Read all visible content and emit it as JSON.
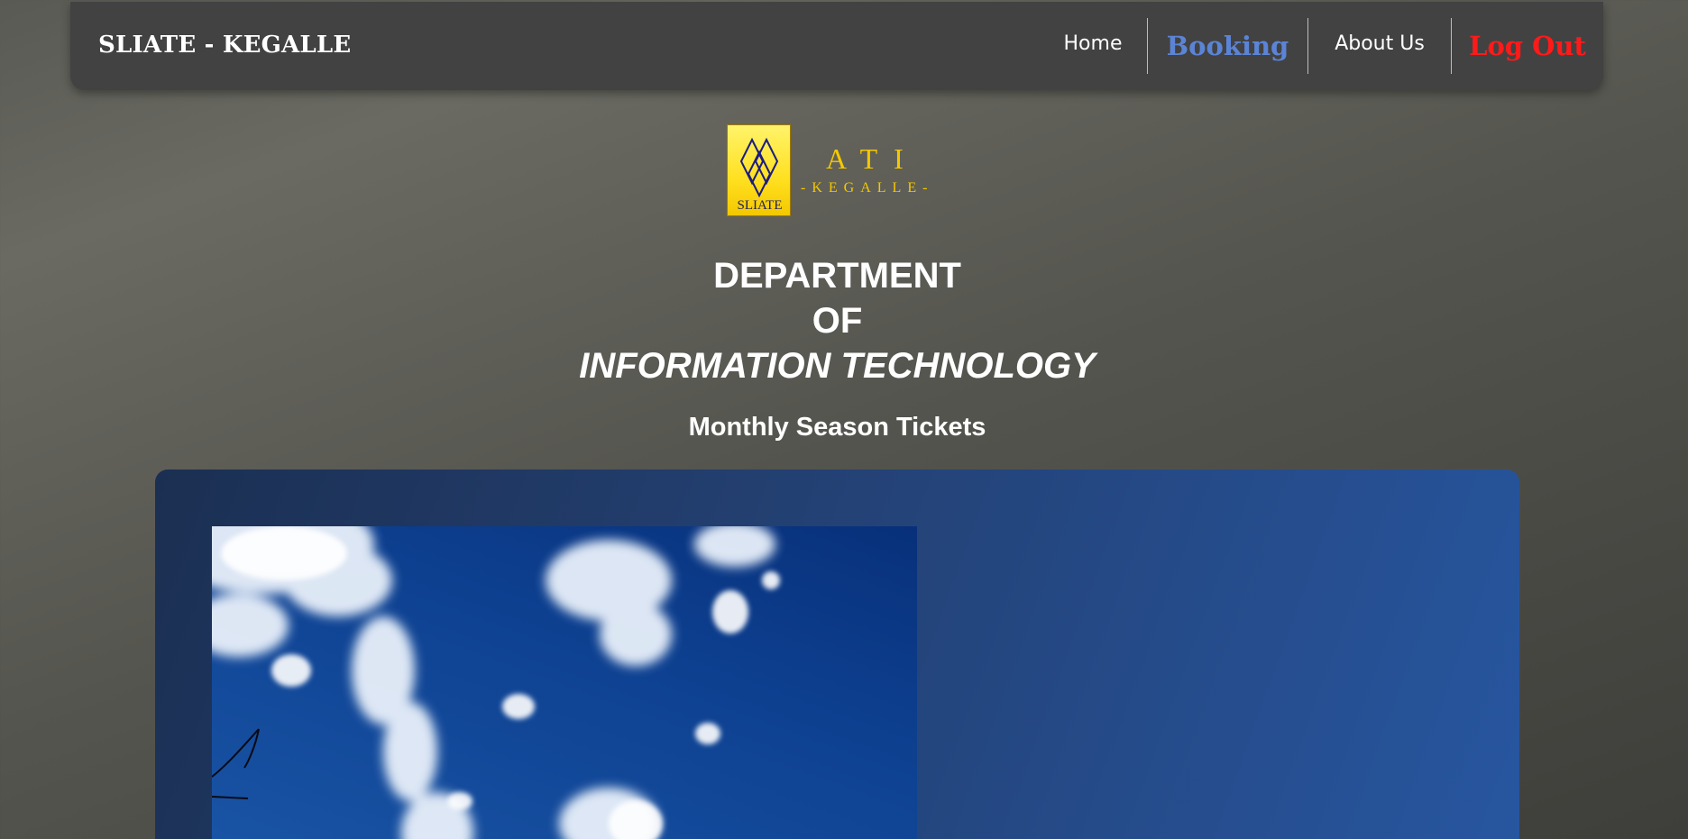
{
  "navbar": {
    "brand": "SLIATE - KEGALLE",
    "links": [
      {
        "label": "Home"
      },
      {
        "label": "Booking"
      },
      {
        "label": "About Us"
      },
      {
        "label": "Log Out"
      }
    ]
  },
  "logo": {
    "box_text": "SLIATE",
    "title": "ATI",
    "subtitle": "-KEGALLE-"
  },
  "headings": {
    "line1": "DEPARTMENT",
    "line2": "OF",
    "line3": "INFORMATION TECHNOLOGY",
    "subtitle": "Monthly Season Tickets"
  },
  "colors": {
    "booking_link": "#5b84d6",
    "logout_link": "#ff1a1a",
    "logo_gold": "#f5c800",
    "panel_blue": "#2756a0"
  },
  "icons": {
    "logo_emblem": "interlocking-diamonds-emblem"
  }
}
